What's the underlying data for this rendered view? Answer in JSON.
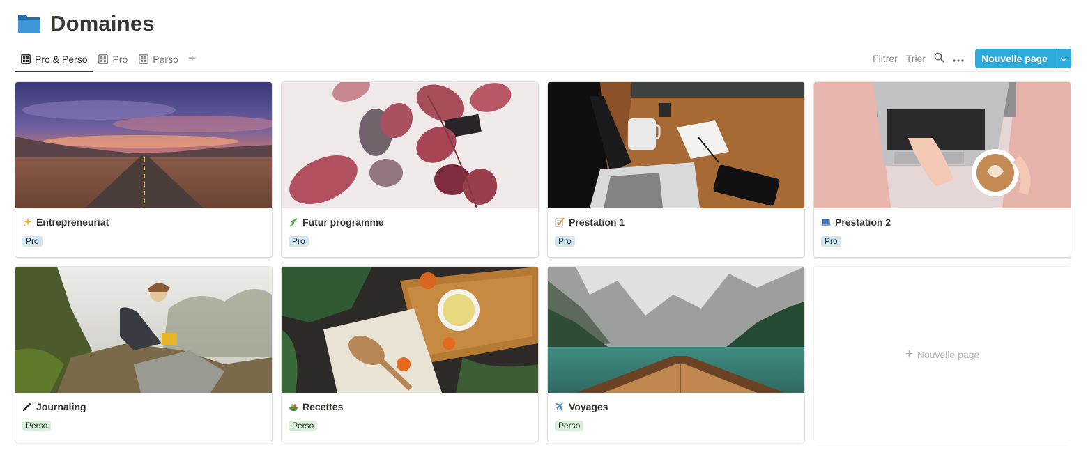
{
  "page": {
    "title": "Domaines",
    "icon": "folder-icon"
  },
  "views": [
    {
      "label": "Pro & Perso",
      "icon": "gallery-icon",
      "active": true
    },
    {
      "label": "Pro",
      "icon": "gallery-icon",
      "active": false
    },
    {
      "label": "Perso",
      "icon": "gallery-icon",
      "active": false
    }
  ],
  "toolbar": {
    "filter_label": "Filtrer",
    "sort_label": "Trier",
    "search_icon": "search-icon",
    "more_icon": "more-icon",
    "new_label": "Nouvelle page"
  },
  "colors": {
    "accent": "#2eaadc",
    "tag_pro_bg": "#d3e5ef",
    "tag_perso_bg": "#dbeddb"
  },
  "cards": [
    {
      "title": "Entrepreneuriat",
      "icon": "sparkles-icon",
      "tag": "Pro"
    },
    {
      "title": "Futur programme",
      "icon": "herb-icon",
      "tag": "Pro"
    },
    {
      "title": "Prestation 1",
      "icon": "memo-icon",
      "tag": "Pro"
    },
    {
      "title": "Prestation 2",
      "icon": "laptop-icon",
      "tag": "Pro"
    },
    {
      "title": "Journaling",
      "icon": "pen-icon",
      "tag": "Perso"
    },
    {
      "title": "Recettes",
      "icon": "salad-icon",
      "tag": "Perso"
    },
    {
      "title": "Voyages",
      "icon": "airplane-icon",
      "tag": "Perso"
    }
  ],
  "new_card": {
    "label": "Nouvelle page"
  }
}
